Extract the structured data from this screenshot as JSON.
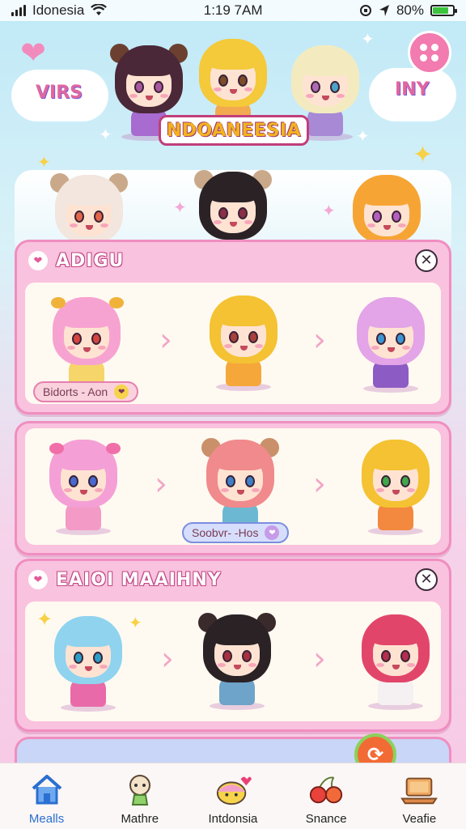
{
  "status_bar": {
    "carrier": "Idonesia",
    "time": "1:19 7AM",
    "battery_percent": "80%",
    "battery_level": 0.8
  },
  "header": {
    "cloud_left_text": "VIRS",
    "cloud_right_text": "INY",
    "title": "NDOANEESIA"
  },
  "cards": [
    {
      "title": "ADIGU",
      "pill_text": "Bidorts - Aon",
      "pill_color": "#f9d2dd"
    },
    {
      "title": "",
      "pill_text": "Soobvr- -Hos",
      "pill_color": "#d6defb"
    },
    {
      "title": "EAIOI MAAIHNY",
      "pill_text": "",
      "pill_color": ""
    }
  ],
  "tabs": [
    {
      "label": "Mealls",
      "icon": "home-icon",
      "active": true
    },
    {
      "label": "Mathre",
      "icon": "character-icon",
      "active": false
    },
    {
      "label": "Intdonsia",
      "icon": "mascot-icon",
      "active": false
    },
    {
      "label": "Snance",
      "icon": "cherries-icon",
      "active": false
    },
    {
      "label": "Veafie",
      "icon": "laptop-icon",
      "active": false
    }
  ],
  "colors": {
    "accent_pink": "#f08ec0",
    "card_fill": "#f9c2de",
    "active_tab": "#2a6fd1"
  }
}
